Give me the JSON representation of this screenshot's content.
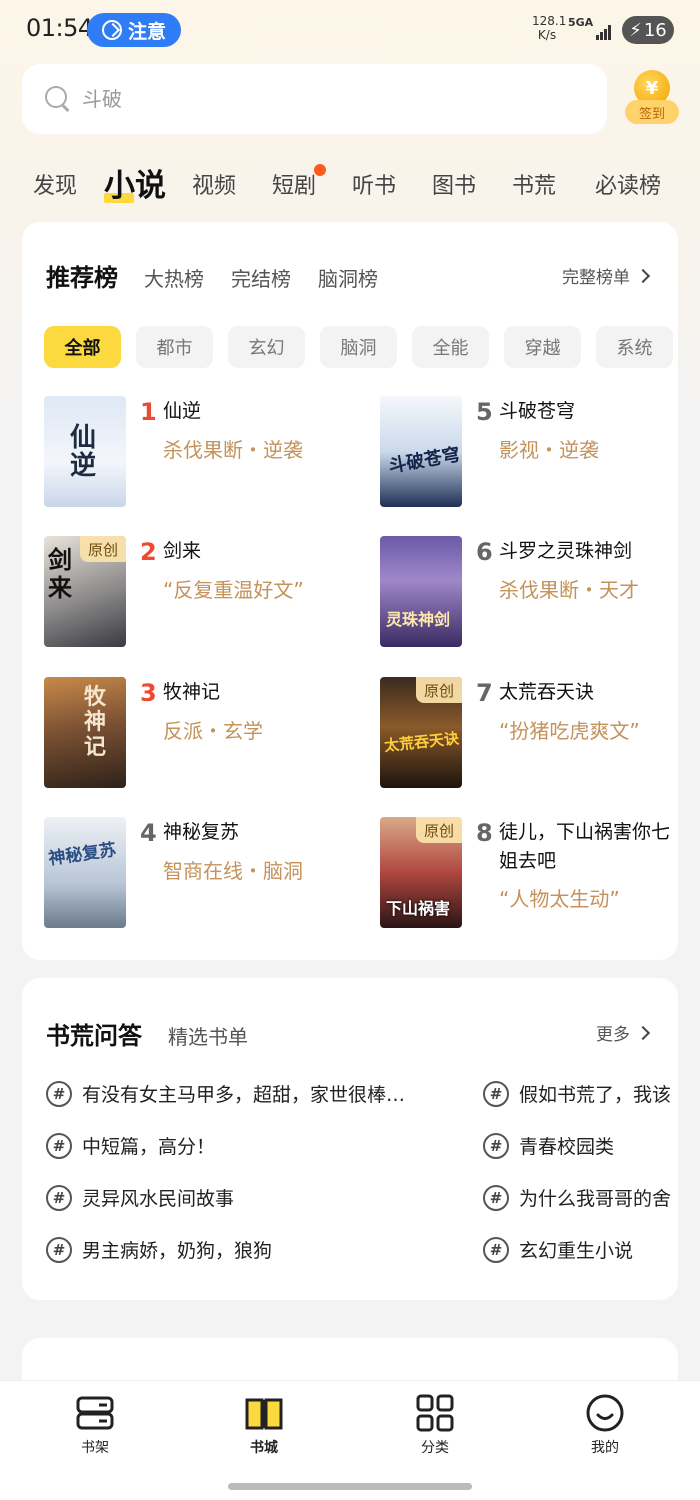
{
  "status": {
    "time": "01:54",
    "notice": "注意",
    "speed": "128.1 K/s",
    "speed_value": "128.1",
    "speed_unit": "K/s",
    "network": "5GA",
    "battery": "16"
  },
  "search": {
    "placeholder": "斗破",
    "checkin_icon": "¥",
    "checkin_label": "签到"
  },
  "tabs": [
    "发现",
    "小说",
    "视频",
    "短剧",
    "听书",
    "图书",
    "书荒",
    "必读榜"
  ],
  "active_tab": "小说",
  "ranking": {
    "title": "推荐榜",
    "subtabs": [
      "大热榜",
      "完结榜",
      "脑洞榜"
    ],
    "more": "完整榜单",
    "chips": [
      "全部",
      "都市",
      "玄幻",
      "脑洞",
      "全能",
      "穿越",
      "系统"
    ],
    "books": [
      {
        "rank": "1",
        "title": "仙逆",
        "tag": "杀伐果断・逆袭",
        "cover_text": "仙逆",
        "original": ""
      },
      {
        "rank": "2",
        "title": "剑来",
        "tag": "“反复重温好文”",
        "cover_text": "剑来",
        "original": "原创"
      },
      {
        "rank": "3",
        "title": "牧神记",
        "tag": "反派・玄学",
        "cover_text": "牧神记",
        "original": ""
      },
      {
        "rank": "4",
        "title": "神秘复苏",
        "tag": "智商在线・脑洞",
        "cover_text": "神秘复苏",
        "original": ""
      },
      {
        "rank": "5",
        "title": "斗破苍穹",
        "tag": "影视・逆袭",
        "cover_text": "斗破苍穹",
        "original": ""
      },
      {
        "rank": "6",
        "title": "斗罗之灵珠神剑",
        "tag": "杀伐果断・天才",
        "cover_text": "灵珠神剑",
        "original": ""
      },
      {
        "rank": "7",
        "title": "太荒吞天诀",
        "tag": "“扮猪吃虎爽文”",
        "cover_text": "太荒吞天诀",
        "original": "原创"
      },
      {
        "rank": "8",
        "title": "徒儿，下山祸害你七姐去吧",
        "tag": "“人物太生动”",
        "cover_text": "下山祸害",
        "original": "原创"
      }
    ]
  },
  "qa": {
    "title": "书荒问答",
    "subtitle": "精选书单",
    "more": "更多",
    "topics_left": [
      "有没有女主马甲多，超甜，家世很棒…",
      "中短篇，高分！",
      "灵异风水民间故事",
      "男主病娇，奶狗，狼狗"
    ],
    "topics_right": [
      "假如书荒了，我该",
      "青春校园类",
      "为什么我哥哥的舍",
      "玄幻重生小说"
    ]
  },
  "bottom_nav": [
    "书架",
    "书城",
    "分类",
    "我的"
  ],
  "active_nav": "书城",
  "colors": {
    "accent": "#fcd93f",
    "rank_red": "#ee4a32",
    "tag_gold": "#c4925a",
    "notice_blue": "#2f7df6"
  }
}
